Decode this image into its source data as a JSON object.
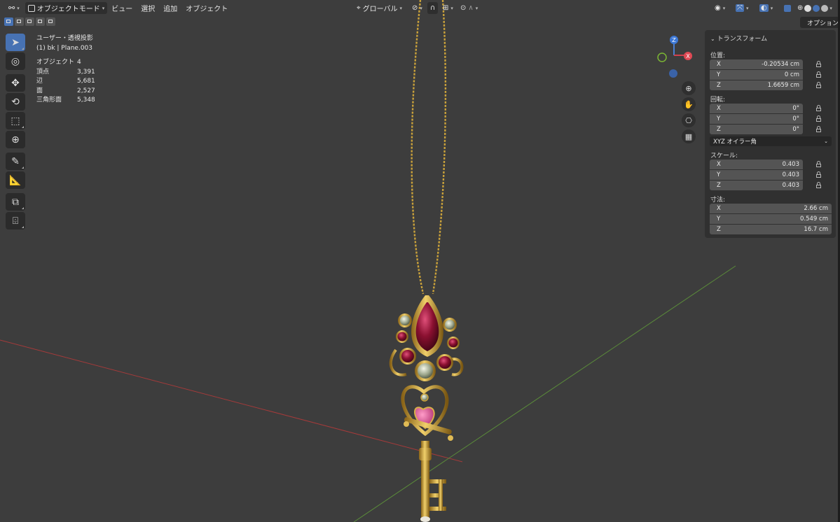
{
  "header": {
    "mode_label": "オブジェクトモード",
    "menus": [
      "ビュー",
      "選択",
      "追加",
      "オブジェクト"
    ],
    "transform_orientation": "グローバル",
    "options_label": "オプション"
  },
  "overlay_info": {
    "view_name": "ユーザー・透視投影",
    "active_object": "(1) bk | Plane.003",
    "stats": [
      {
        "label": "オブジェクト",
        "value": "4"
      },
      {
        "label": "頂点",
        "value": "3,391"
      },
      {
        "label": "辺",
        "value": "5,681"
      },
      {
        "label": "面",
        "value": "2,527"
      },
      {
        "label": "三角形面",
        "value": "5,348"
      }
    ]
  },
  "gizmo": {
    "x": "X",
    "z": "Z"
  },
  "transform_panel": {
    "title": "トランスフォーム",
    "location": {
      "label": "位置:",
      "x": "-0.20534 cm",
      "y": "0 cm",
      "z": "1.6659 cm"
    },
    "rotation": {
      "label": "回転:",
      "x": "0°",
      "y": "0°",
      "z": "0°"
    },
    "rotation_mode": "XYZ オイラー角",
    "scale": {
      "label": "スケール:",
      "x": "0.403",
      "y": "0.403",
      "z": "0.403"
    },
    "dimensions": {
      "label": "寸法:",
      "x": "2.66 cm",
      "y": "0.549 cm",
      "z": "16.7 cm"
    },
    "axis_labels": {
      "x": "X",
      "y": "Y",
      "z": "Z"
    }
  },
  "colors": {
    "viewport": "#3d3d3d",
    "x_axis": "#b33a3a",
    "y_axis": "#5f8f3a",
    "gold": "#c9a13a",
    "ruby": "#9a1838",
    "accent": "#4772b3"
  }
}
